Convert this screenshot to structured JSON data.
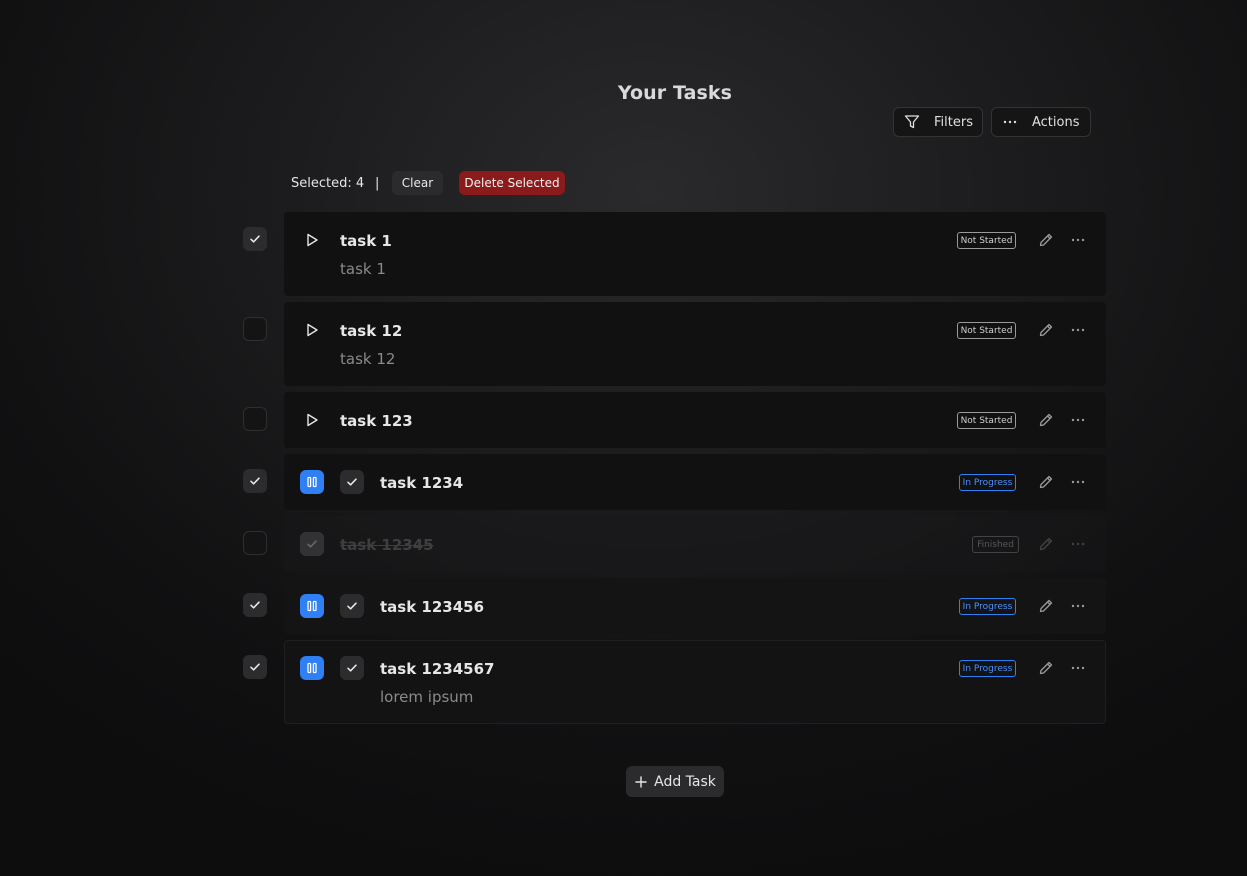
{
  "header": {
    "title": "Your Tasks"
  },
  "toolbar": {
    "filters_label": "Filters",
    "actions_label": "Actions"
  },
  "selection": {
    "count_text": "Selected: 4",
    "separator": "|",
    "clear_label": "Clear",
    "delete_label": "Delete Selected"
  },
  "tasks": [
    {
      "title": "task 1",
      "description": "task 1",
      "status": "Not Started",
      "selected": true
    },
    {
      "title": "task 12",
      "description": "task 12",
      "status": "Not Started",
      "selected": false
    },
    {
      "title": "task 123",
      "description": "",
      "status": "Not Started",
      "selected": false
    },
    {
      "title": "task 1234",
      "description": "",
      "status": "In Progress",
      "selected": true
    },
    {
      "title": "task 12345",
      "description": "",
      "status": "Finished",
      "selected": false
    },
    {
      "title": "task 123456",
      "description": "",
      "status": "In Progress",
      "selected": true
    },
    {
      "title": "task 1234567",
      "description": "lorem ipsum",
      "status": "In Progress",
      "selected": true
    }
  ],
  "footer": {
    "add_label": "Add Task"
  },
  "colors": {
    "accent_blue": "#2f7ff5",
    "danger": "#8b1a1a"
  }
}
